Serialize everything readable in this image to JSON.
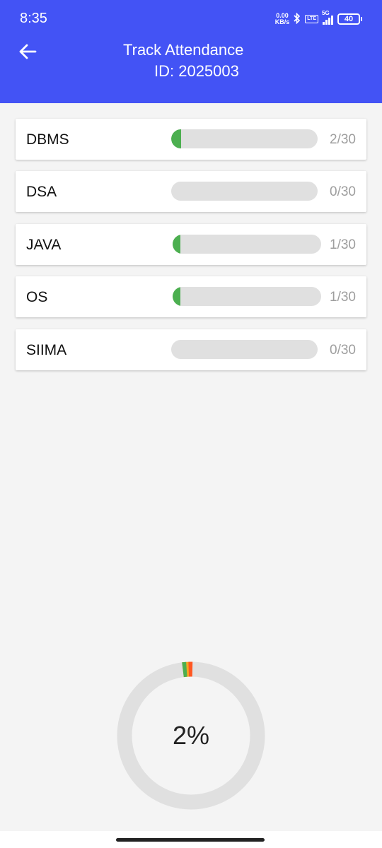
{
  "status_bar": {
    "time": "8:35",
    "net_speed_value": "0.00",
    "net_speed_unit": "KB/s",
    "volte": "VoLTE",
    "network": "5G",
    "battery": "40"
  },
  "header": {
    "title": "Track Attendance",
    "subtitle": "ID: 2025003",
    "back_icon": "arrow-left-icon",
    "background": "#4353f5"
  },
  "subjects": [
    {
      "name": "DBMS",
      "attended": 2,
      "total": 30,
      "count_label": "2/30"
    },
    {
      "name": "DSA",
      "attended": 0,
      "total": 30,
      "count_label": "0/30"
    },
    {
      "name": "JAVA",
      "attended": 1,
      "total": 30,
      "count_label": "1/30"
    },
    {
      "name": "OS",
      "attended": 1,
      "total": 30,
      "count_label": "1/30"
    },
    {
      "name": "SIIMA",
      "attended": 0,
      "total": 30,
      "count_label": "0/30"
    }
  ],
  "overall": {
    "percent_label": "2%",
    "percent": 2,
    "colors": {
      "track": "#e0e0e0",
      "progress": "#4caf50",
      "accent_1": "#f5a623",
      "accent_2": "#ff5722"
    }
  },
  "colors": {
    "progress_fill": "#4caf50",
    "progress_track": "#e0e0e0",
    "count_text": "#9e9e9e"
  }
}
